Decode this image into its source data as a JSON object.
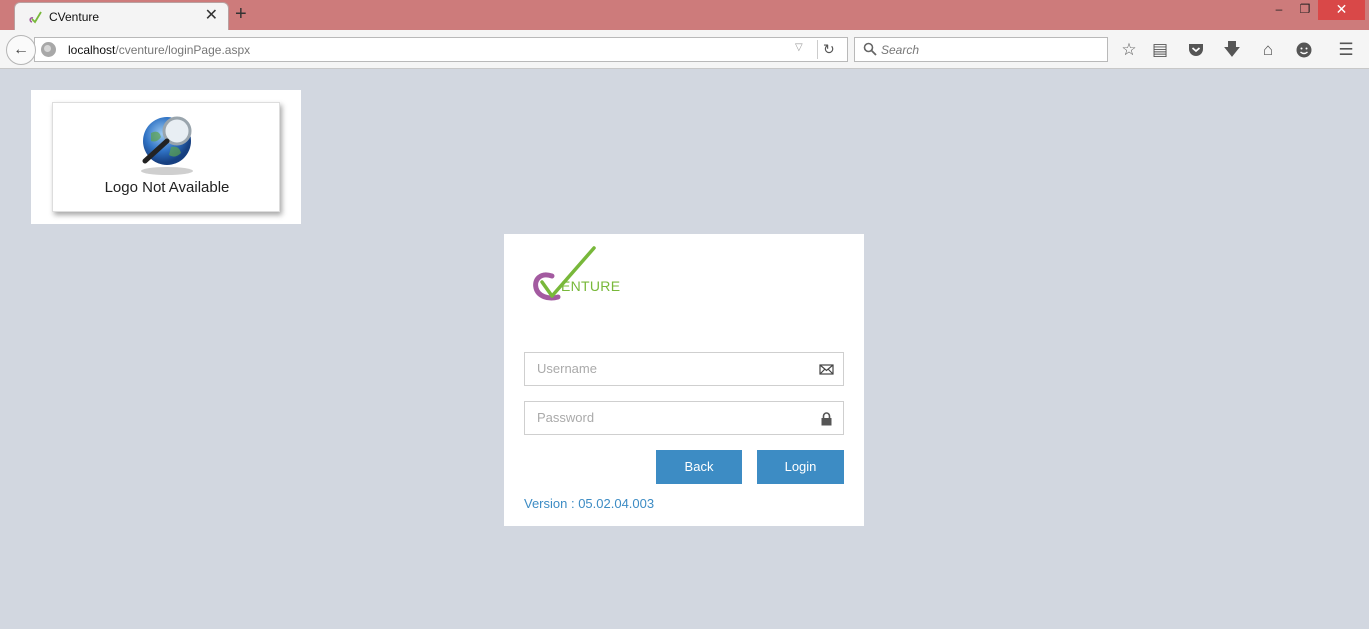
{
  "browser": {
    "tab_title": "CVenture",
    "close_tab_glyph": "✕",
    "new_tab_glyph": "+",
    "url_host": "localhost",
    "url_path": "/cventure/loginPage.aspx",
    "search_placeholder": "Search",
    "window_controls": {
      "minimize": "–",
      "maximize": "❐",
      "close": "✕"
    },
    "toolbar_icons": [
      "bookmark-star-icon",
      "reading-list-icon",
      "pocket-icon",
      "download-icon",
      "home-icon",
      "hello-icon",
      "menu-icon"
    ]
  },
  "page": {
    "logo_placeholder_text": "Logo Not Available",
    "brand_text": "ENTURE",
    "username_placeholder": "Username",
    "password_placeholder": "Password",
    "back_label": "Back",
    "login_label": "Login",
    "version_text": "Version : 05.02.04.003"
  },
  "colors": {
    "titlebar": "#cd7b7b",
    "page_background": "#d2d7e0",
    "button": "#3d8cc4",
    "brand_green": "#78b83a",
    "brand_purple": "#a35aa0"
  }
}
